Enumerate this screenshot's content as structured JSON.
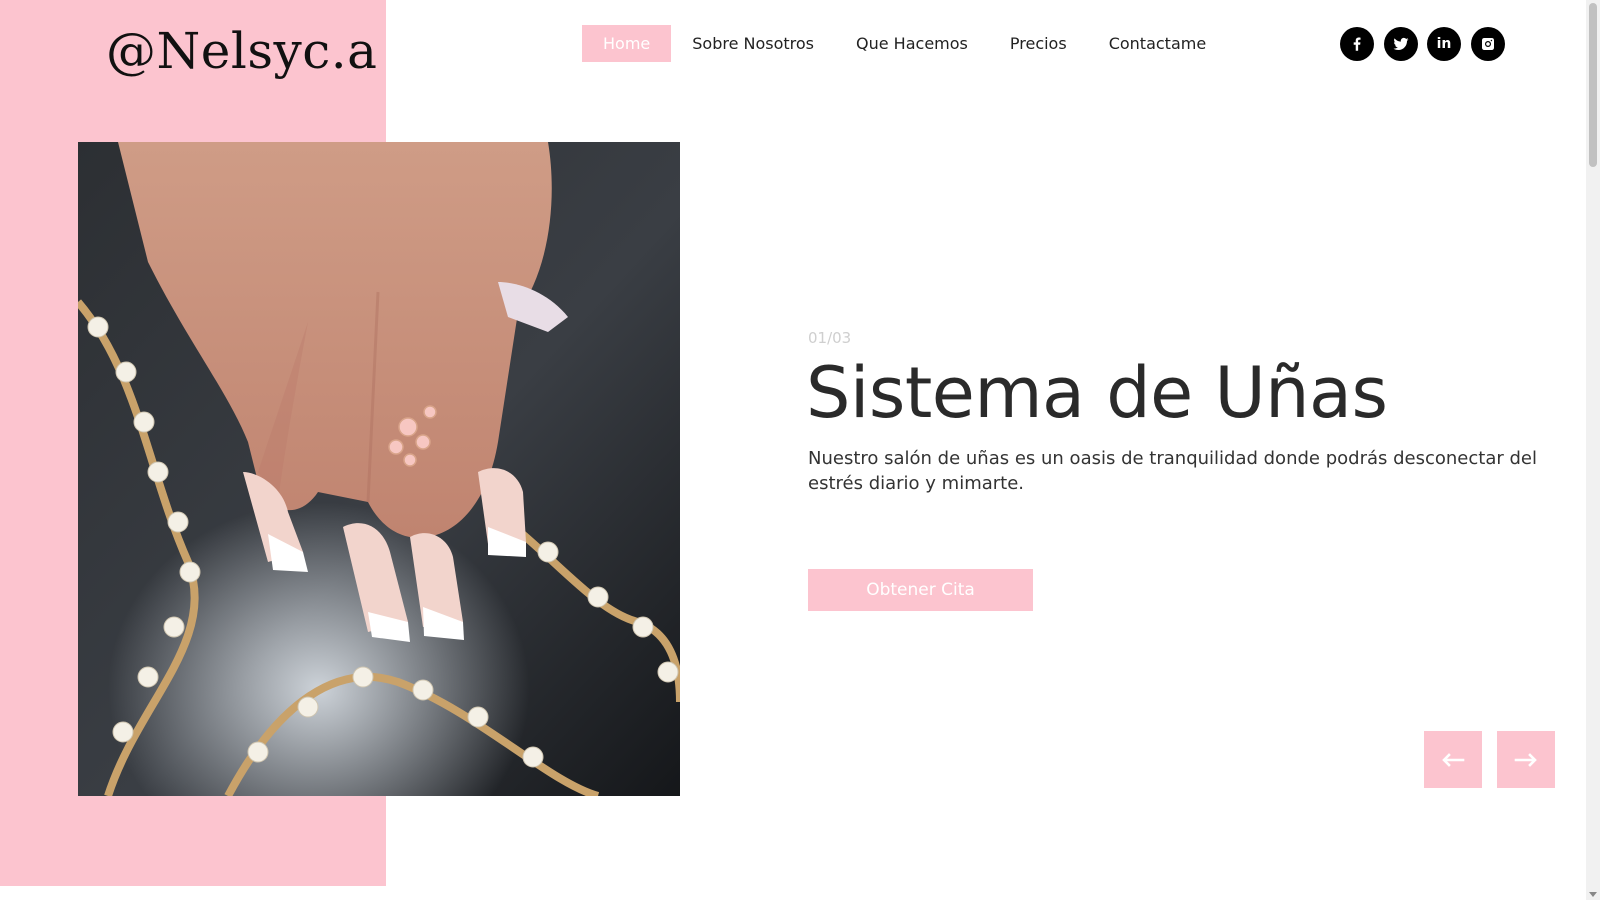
{
  "brand": {
    "logo_text": "@Nelsyc.a"
  },
  "nav": {
    "items": [
      {
        "label": "Home",
        "active": true
      },
      {
        "label": "Sobre Nosotros"
      },
      {
        "label": "Que Hacemos"
      },
      {
        "label": "Precios"
      },
      {
        "label": "Contactame"
      }
    ]
  },
  "socials": [
    {
      "icon": "facebook-icon"
    },
    {
      "icon": "twitter-icon"
    },
    {
      "icon": "linkedin-icon",
      "text": "in"
    },
    {
      "icon": "instagram-icon"
    }
  ],
  "slider": {
    "counter": "01/03",
    "title": "Sistema de Uñas",
    "description": "Nuestro salón de uñas es un oasis de tranquilidad donde podrás desconectar del estrés diario y mimarte.",
    "cta_label": "Obtener Cita",
    "prev_icon": "arrow-left-icon",
    "next_icon": "arrow-right-icon"
  },
  "colors": {
    "accent": "#fcc4cf",
    "text": "#2a2a2a",
    "background": "#ffffff"
  }
}
